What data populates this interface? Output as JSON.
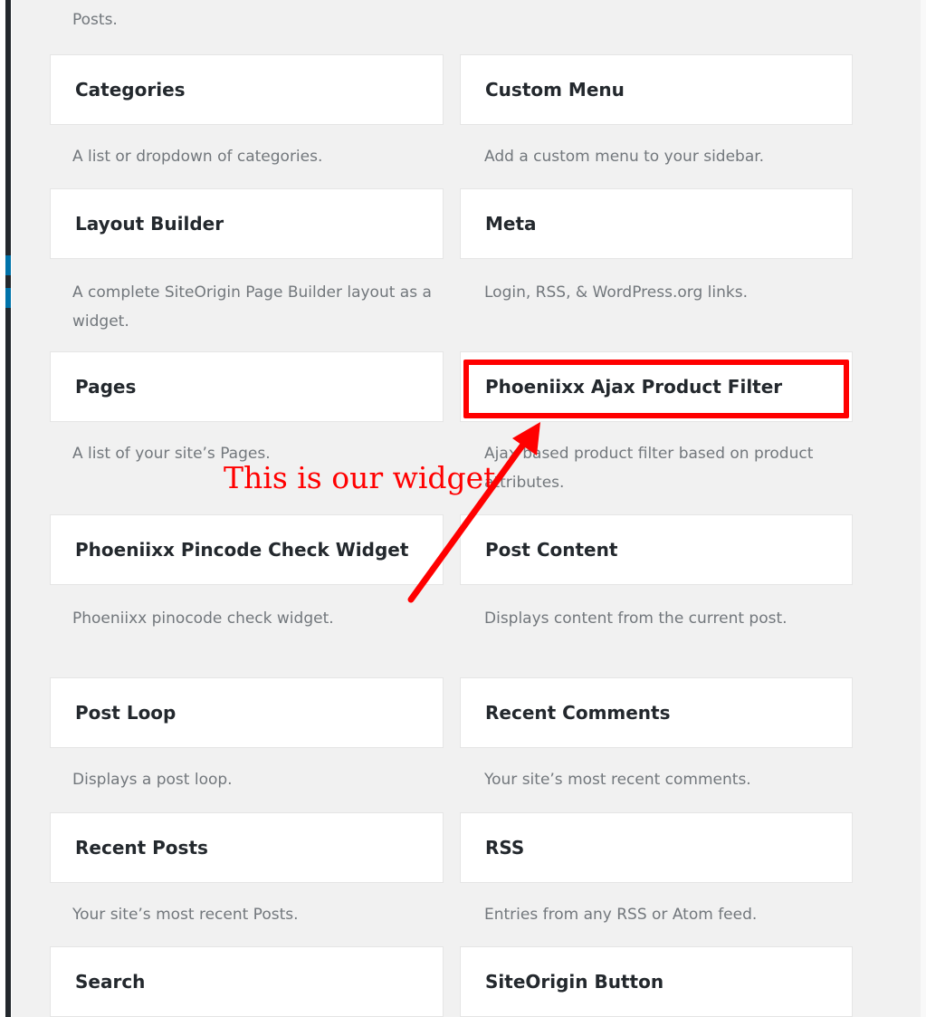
{
  "top_description": "Posts.",
  "widgets": [
    {
      "title": "Categories",
      "description": "A list or dropdown of categories."
    },
    {
      "title": "Custom Menu",
      "description": "Add a custom menu to your sidebar."
    },
    {
      "title": "Layout Builder",
      "description": "A complete SiteOrigin Page Builder layout as a widget."
    },
    {
      "title": "Meta",
      "description": "Login, RSS, & WordPress.org links."
    },
    {
      "title": "Pages",
      "description": "A list of your site’s Pages."
    },
    {
      "title": "Phoeniixx Ajax Product Filter",
      "description": "Ajax based product filter based on product attributes."
    },
    {
      "title": "Phoeniixx Pincode Check Widget",
      "description": "Phoeniixx pinocode check widget."
    },
    {
      "title": "Post Content",
      "description": "Displays content from the current post."
    },
    {
      "title": "Post Loop",
      "description": "Displays a post loop."
    },
    {
      "title": "Recent Comments",
      "description": "Your site’s most recent comments."
    },
    {
      "title": "Recent Posts",
      "description": "Your site’s most recent Posts."
    },
    {
      "title": "RSS",
      "description": "Entries from any RSS or Atom feed."
    },
    {
      "title": "Search",
      "description": ""
    },
    {
      "title": "SiteOrigin Button",
      "description": ""
    }
  ],
  "annotation": {
    "text": "This is our widget",
    "color": "#ff0000"
  }
}
